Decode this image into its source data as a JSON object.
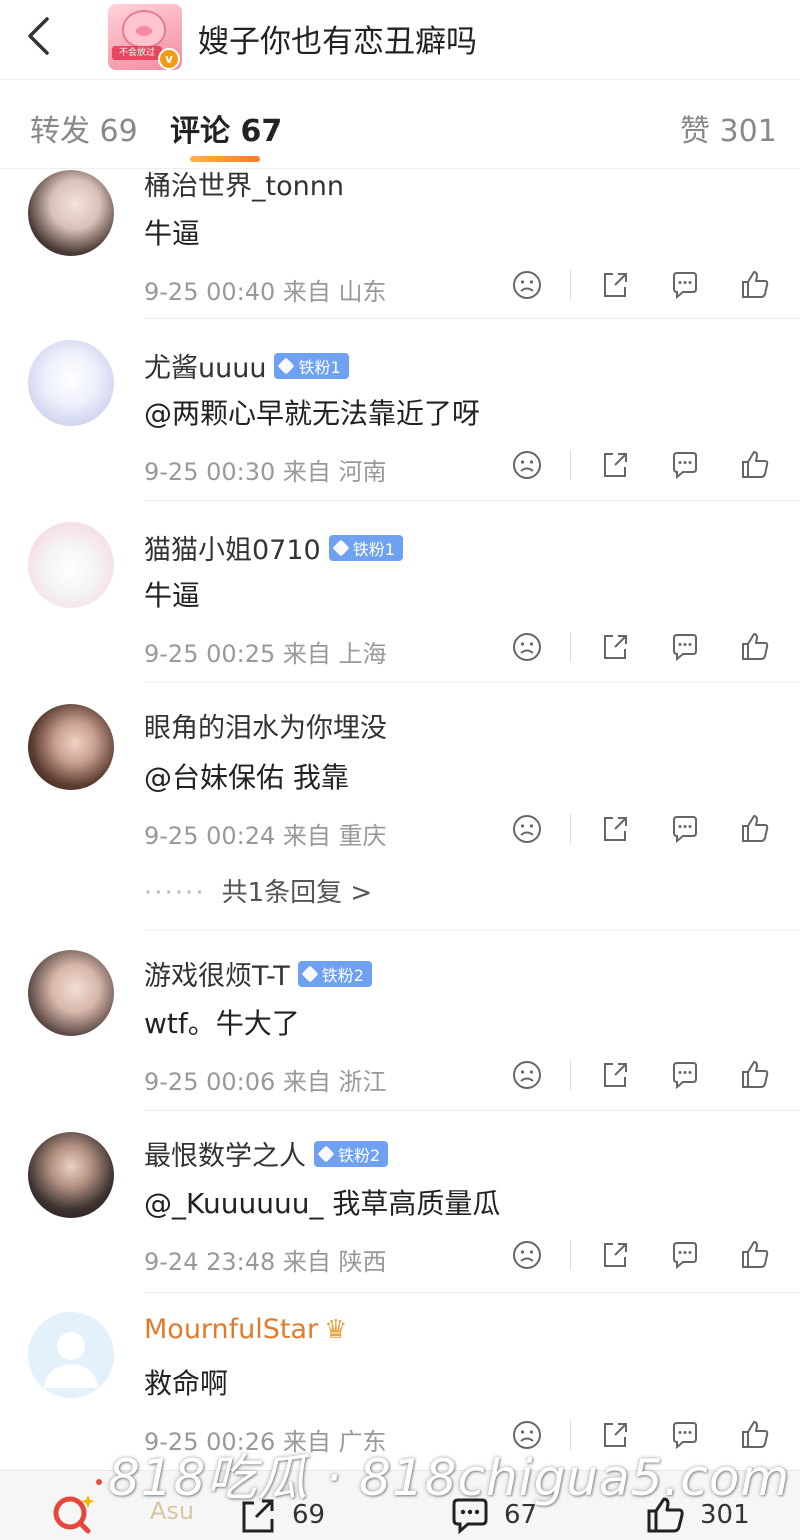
{
  "header": {
    "title": "嫂子你也有恋丑癖吗",
    "avatar_tag": "不会放过"
  },
  "tabs": [
    {
      "label": "转发 69",
      "active": false
    },
    {
      "label": "评论 67",
      "active": true
    },
    {
      "label": "赞 301",
      "active": false
    }
  ],
  "comments": [
    {
      "name": "桶治世界_tonnn",
      "badge": "",
      "text": "牛逼",
      "time": "9-25 00:40",
      "from": "来自 山东"
    },
    {
      "name": "尤酱uuuu",
      "badge": "铁粉1",
      "text": "@两颗心早就无法靠近了呀",
      "time": "9-25 00:30",
      "from": "来自 河南"
    },
    {
      "name": "猫猫小姐0710",
      "badge": "铁粉1",
      "text": "牛逼",
      "time": "9-25 00:25",
      "from": "来自 上海"
    },
    {
      "name": "眼角的泪水为你埋没",
      "badge": "",
      "text": "@台妹保佑 我靠",
      "time": "9-25 00:24",
      "from": "来自 重庆",
      "replies": "共1条回复 >"
    },
    {
      "name": "游戏很烦T-T",
      "badge": "铁粉2",
      "text": "wtf。牛大了",
      "time": "9-25 00:06",
      "from": "来自 浙江"
    },
    {
      "name": "最恨数学之人",
      "badge": "铁粉2",
      "text": "@_Kuuuuuu_ 我草高质量瓜",
      "time": "9-24 23:48",
      "from": "来自 陕西"
    },
    {
      "name": "MournfulStar",
      "badge": "",
      "text": "救命啊",
      "time": "9-25 00:26",
      "from": "来自 广东"
    }
  ],
  "reply_dots": "······",
  "bottom": {
    "asu": "Asu",
    "repost_count": "69",
    "comment_count": "67",
    "like_count": "301"
  },
  "watermark": "818吃瓜 · 818chigua5.com",
  "icons": {
    "back": "chevron-left-icon",
    "dislike": "sad-face-icon",
    "share": "share-icon",
    "comment": "comment-icon",
    "like": "thumbs-up-icon",
    "search": "search-icon"
  },
  "colors": {
    "accent": "#ff8a2c",
    "badge": "#6ea1f2",
    "gold_name": "#e07b2c"
  }
}
